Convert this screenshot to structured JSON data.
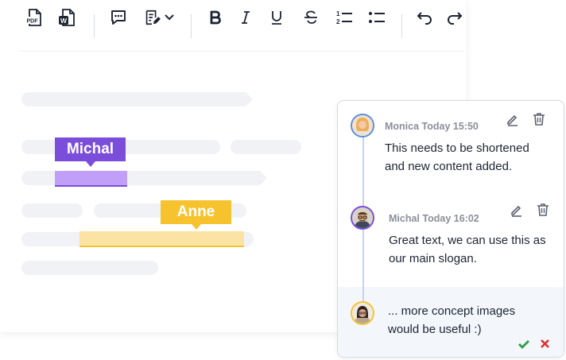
{
  "editor": {
    "toolbar": {
      "pdf_label": "PDF",
      "word_label": "W"
    },
    "tags": [
      {
        "name": "Michal",
        "color": "#7b4ddb",
        "highlight": "#bf9ff7"
      },
      {
        "name": "Anne",
        "color": "#f6c32e",
        "highlight": "#fbe3a3"
      }
    ]
  },
  "comments": [
    {
      "author": "Monica",
      "time": "Today 15:50",
      "text": "This needs to be shortened and new content added."
    },
    {
      "author": "Michal",
      "time": "Today 16:02",
      "text": "Great text, we can use this as our main slogan."
    }
  ],
  "reply": {
    "text": "... more concept images would be useful :)"
  },
  "colors": {
    "confirm": "#2f9e44",
    "cancel": "#e03131",
    "timeline": "#c3d4ee"
  }
}
